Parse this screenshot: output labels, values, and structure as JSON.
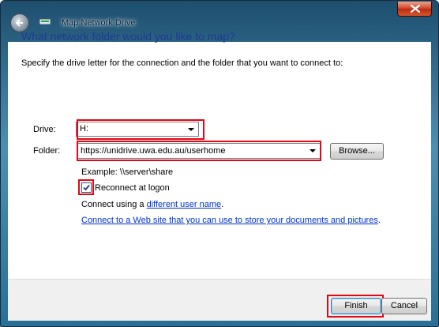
{
  "window": {
    "title": "Map Network Drive"
  },
  "heading": "What network folder would you like to map?",
  "description": "Specify the drive letter for the connection and the folder that you want to connect to:",
  "drive": {
    "label": "Drive:",
    "value": "H:"
  },
  "folder": {
    "label": "Folder:",
    "value": "https://unidrive.uwa.edu.au/userhome",
    "browse_label": "Browse..."
  },
  "example_text": "Example: \\\\server\\share",
  "reconnect": {
    "label": "Reconnect at logon",
    "checked": true
  },
  "connect_using": {
    "prefix": "Connect using a ",
    "link": "different user name",
    "suffix": "."
  },
  "web_link": {
    "link": "Connect to a Web site that you can use to store your documents and pictures",
    "suffix": "."
  },
  "buttons": {
    "finish": "Finish",
    "cancel": "Cancel"
  },
  "colors": {
    "heading": "#1f3a93",
    "link": "#0033cc",
    "highlight": "#e30613"
  },
  "icons": {
    "back": "back-arrow-icon",
    "network": "network-drive-icon",
    "close": "close-icon",
    "caret": "chevron-down-icon",
    "check": "checkmark-icon"
  }
}
